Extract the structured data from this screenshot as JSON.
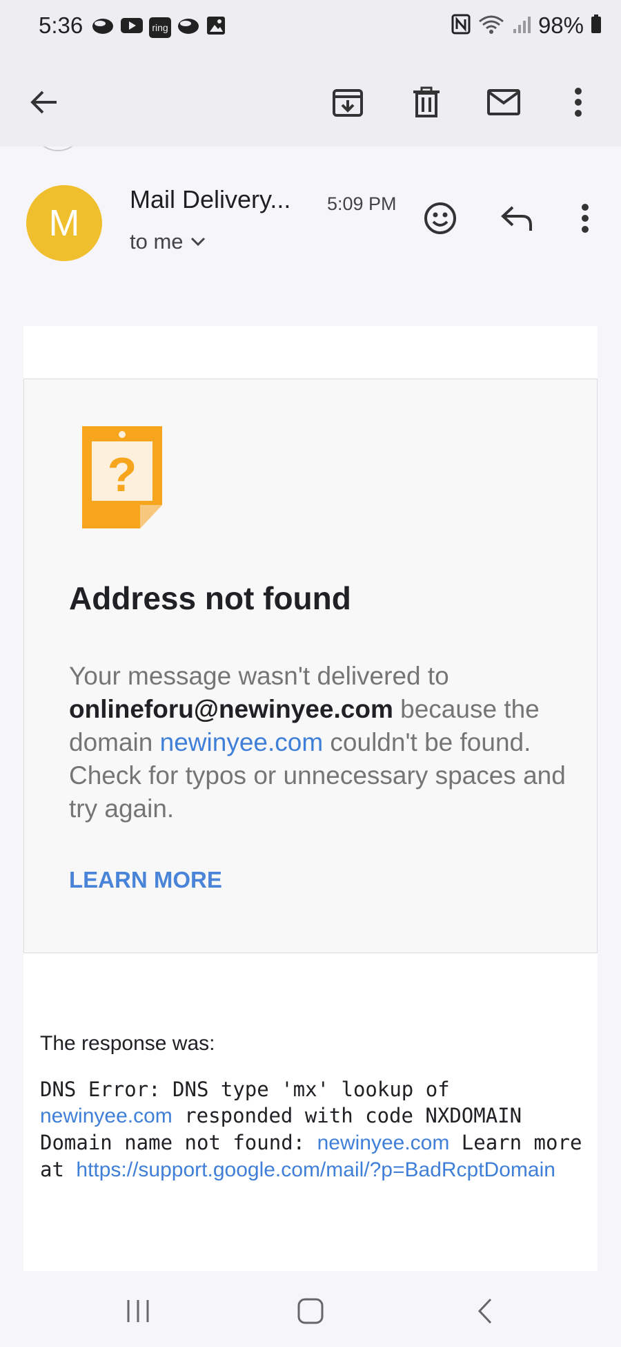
{
  "status": {
    "time": "5:36",
    "ring_label": "ring",
    "battery": "98%"
  },
  "email": {
    "avatar_letter": "M",
    "sender": "Mail Delivery...",
    "time": "5:09 PM",
    "recipient": "to me"
  },
  "card": {
    "title": "Address not found",
    "text_1": "Your message wasn't delivered to ",
    "address": "onlineforu@newinyee.com",
    "text_2": " because the domain ",
    "domain": "newinyee.com",
    "text_3": " couldn't be found. Check for typos or unnecessary spaces and try again.",
    "learn_more": "LEARN MORE"
  },
  "response": {
    "label": "The response was:",
    "part_1": "DNS Error: DNS type 'mx' lookup of ",
    "domain_1": "newinyee.com",
    "part_2": " responded with code NXDOMAIN Domain name not found: ",
    "domain_2": "newinyee.com",
    "part_3": " Learn more at ",
    "url": "https://support.google.com/mail/?p=BadRcptDomain"
  },
  "colors": {
    "avatar": "#f0bf2e",
    "link": "#3f7fd8",
    "warning_icon": "#f7a51c"
  }
}
